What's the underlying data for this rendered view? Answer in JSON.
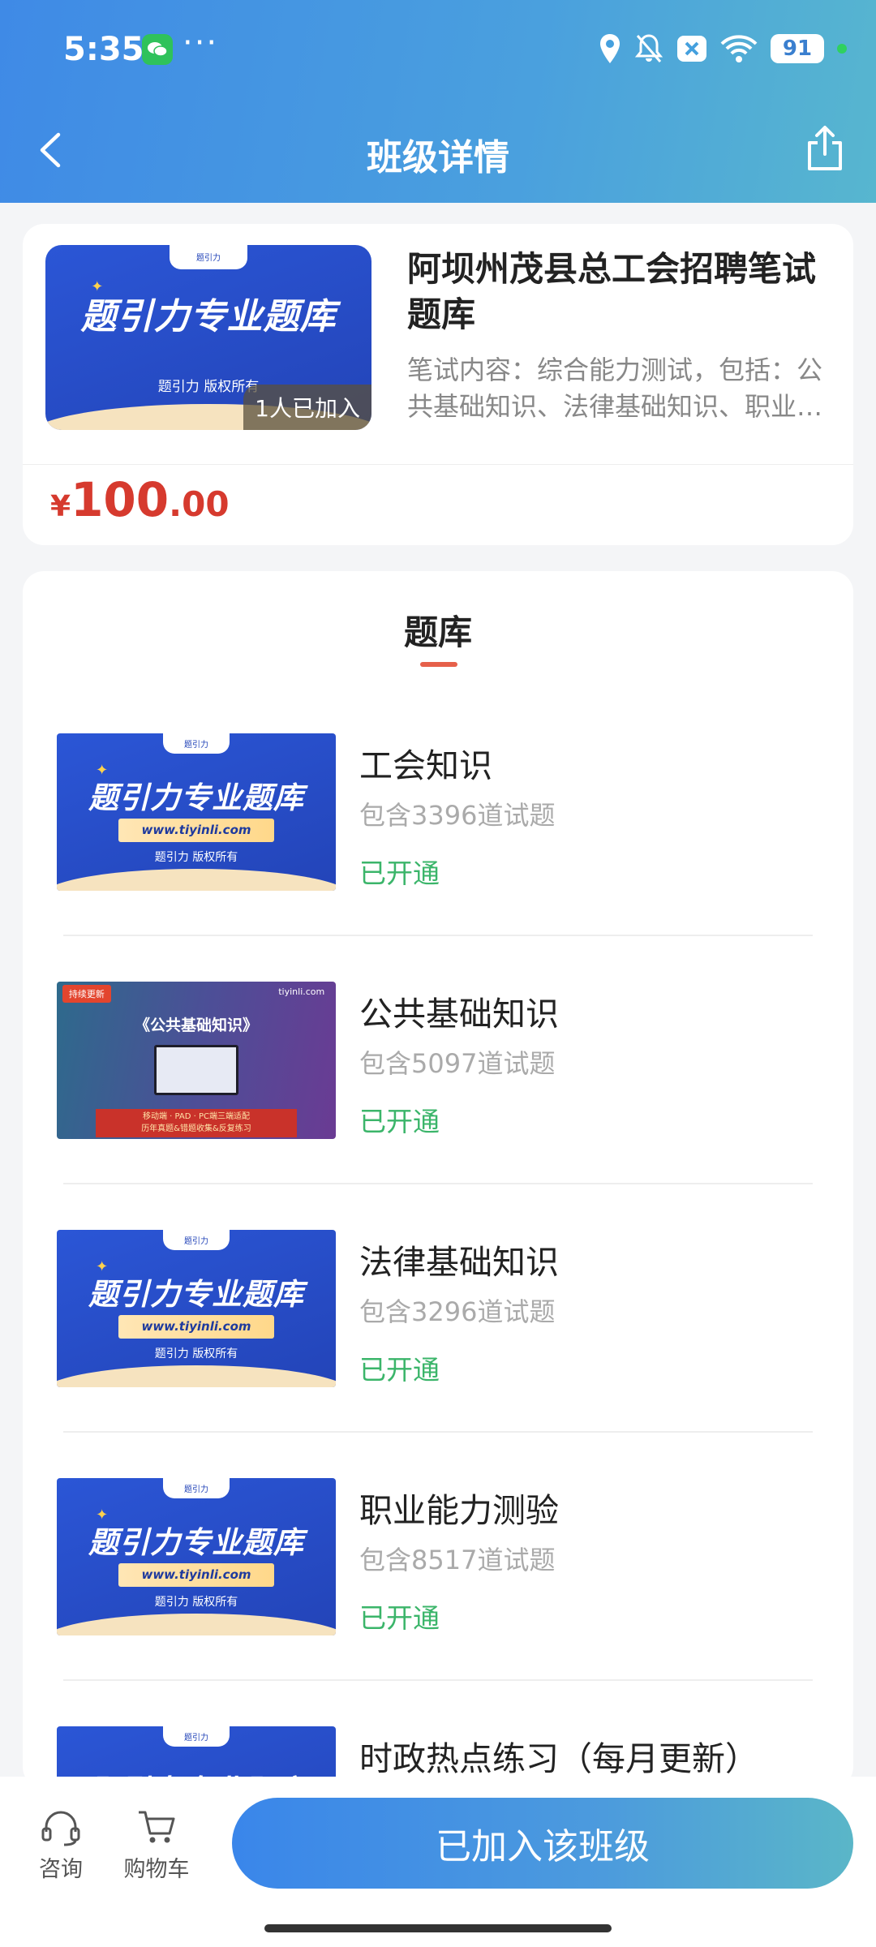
{
  "status_bar": {
    "time": "5:35",
    "dots": "···",
    "battery": "91"
  },
  "nav": {
    "title": "班级详情"
  },
  "course": {
    "thumb": {
      "tab": "题引力",
      "big": "题引力专业题库",
      "copy": "题引力 版权所有"
    },
    "joined_badge": "1人已加入",
    "title": "阿坝州茂县总工会招聘笔试题库",
    "desc": "笔试内容：综合能力测试，包括：公共基础知识、法律基础知识、职业能力测验等",
    "price_symbol": "¥",
    "price_int": "100",
    "price_dec": ".00"
  },
  "section": {
    "title": "题库"
  },
  "thumb_blue": {
    "tab": "题引力",
    "big": "题引力专业题库",
    "url": "www.tiyinli.com",
    "copy": "题引力 版权所有"
  },
  "thumb_public": {
    "tag": "持续更新",
    "brand": "tiyinli.com",
    "heading": "《公共基础知识》",
    "banner_line1": "移动端 · PAD · PC端三端适配",
    "banner_line2": "历年真题&错题收集&反复练习"
  },
  "items": [
    {
      "name": "工会知识",
      "count": "包含3396道试题",
      "status": "已开通"
    },
    {
      "name": "公共基础知识",
      "count": "包含5097道试题",
      "status": "已开通"
    },
    {
      "name": "法律基础知识",
      "count": "包含3296道试题",
      "status": "已开通"
    },
    {
      "name": "职业能力测验",
      "count": "包含8517道试题",
      "status": "已开通"
    },
    {
      "name": "时政热点练习（每月更新）"
    }
  ],
  "bottom": {
    "consult": "咨询",
    "cart": "购物车",
    "join_button": "已加入该班级"
  },
  "colors": {
    "header_start": "#3f8ae6",
    "header_end": "#57b6cf",
    "price": "#d63a2e",
    "opened": "#3bb56a",
    "accent_underline": "#e6604a"
  }
}
